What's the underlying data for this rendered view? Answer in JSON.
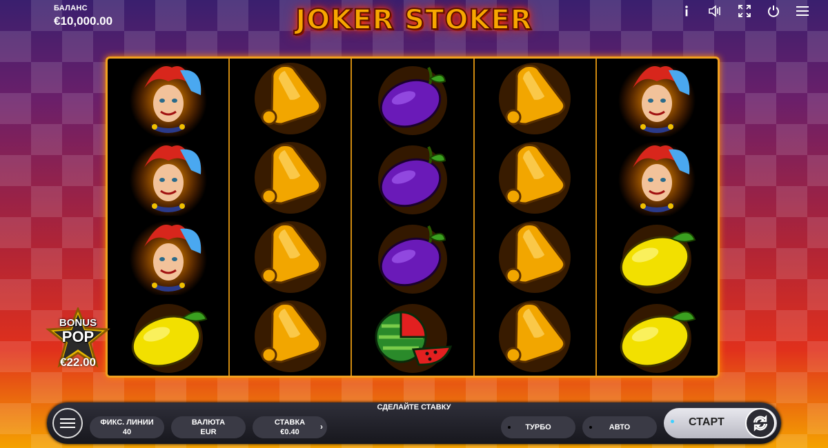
{
  "header": {
    "balance_label": "БАЛАНС",
    "balance_value": "€10,000.00",
    "logo_text": "JOKER STOKER",
    "icons": [
      "info-icon",
      "sound-icon",
      "fullscreen-icon",
      "power-icon",
      "hamburger-icon"
    ]
  },
  "reels": [
    [
      "joker",
      "joker",
      "joker",
      "lemon"
    ],
    [
      "bell",
      "bell",
      "bell",
      "bell"
    ],
    [
      "plum",
      "plum",
      "plum",
      "watermelon"
    ],
    [
      "bell",
      "bell",
      "bell",
      "bell"
    ],
    [
      "joker",
      "joker",
      "lemon",
      "lemon"
    ]
  ],
  "bonus": {
    "line1": "BONUS",
    "line2": "POP",
    "amount": "€22.00"
  },
  "controls": {
    "title": "СДЕЛАЙТЕ СТАВКУ",
    "lines_label": "ФИКС. ЛИНИИ",
    "lines_value": "40",
    "currency_label": "ВАЛЮТА",
    "currency_value": "EUR",
    "bet_label": "СТАВКА",
    "bet_value": "€0.40",
    "bet_arrow": "›",
    "turbo_label": "ТУРБО",
    "auto_label": "АВТО",
    "start_label": "СТАРТ"
  },
  "colors": {
    "reel_border": "#f0a020",
    "accent_dot": "#3fd0ff"
  }
}
